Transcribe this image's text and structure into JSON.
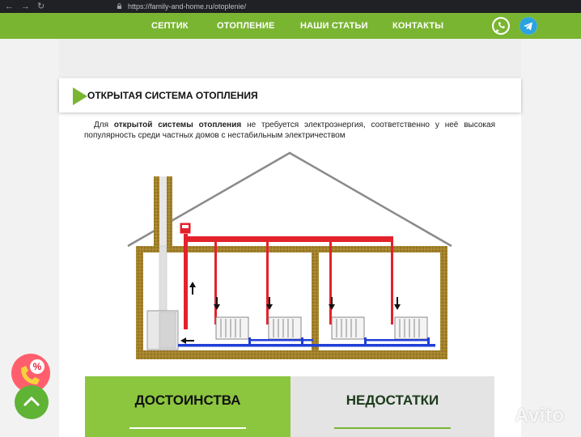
{
  "browser": {
    "url": "https://family-and-home.ru/otoplenie/",
    "back_glyph": "←",
    "forward_glyph": "→",
    "reload_glyph": "↻"
  },
  "nav": {
    "items": [
      "СЕПТИК",
      "ОТОПЛЕНИЕ",
      "НАШИ СТАТЬИ",
      "КОНТАКТЫ"
    ],
    "accent": "#7ab532"
  },
  "heading": {
    "title": "ОТКРЫТАЯ СИСТЕМА ОТОПЛЕНИЯ"
  },
  "intro": {
    "lead": "Для",
    "bold": "открытой системы отопления",
    "rest": "не требуется электроэнергия, соответственно у неё высокая популярность среди частных домов с нестабильным электричеством"
  },
  "columns": {
    "pros_title": "ДОСТОИНСТВА",
    "cons_title": "НЕДОСТАТКИ"
  },
  "widgets": {
    "promo_symbol": "%",
    "watermark": "Avito"
  },
  "colors": {
    "brand_green": "#7ab532",
    "pros_bg": "#8cc63f",
    "cons_bg": "#e4e4e4",
    "hot_pipe": "#e3222b",
    "cold_pipe": "#1f3fd6",
    "wall": "#a3822c"
  }
}
